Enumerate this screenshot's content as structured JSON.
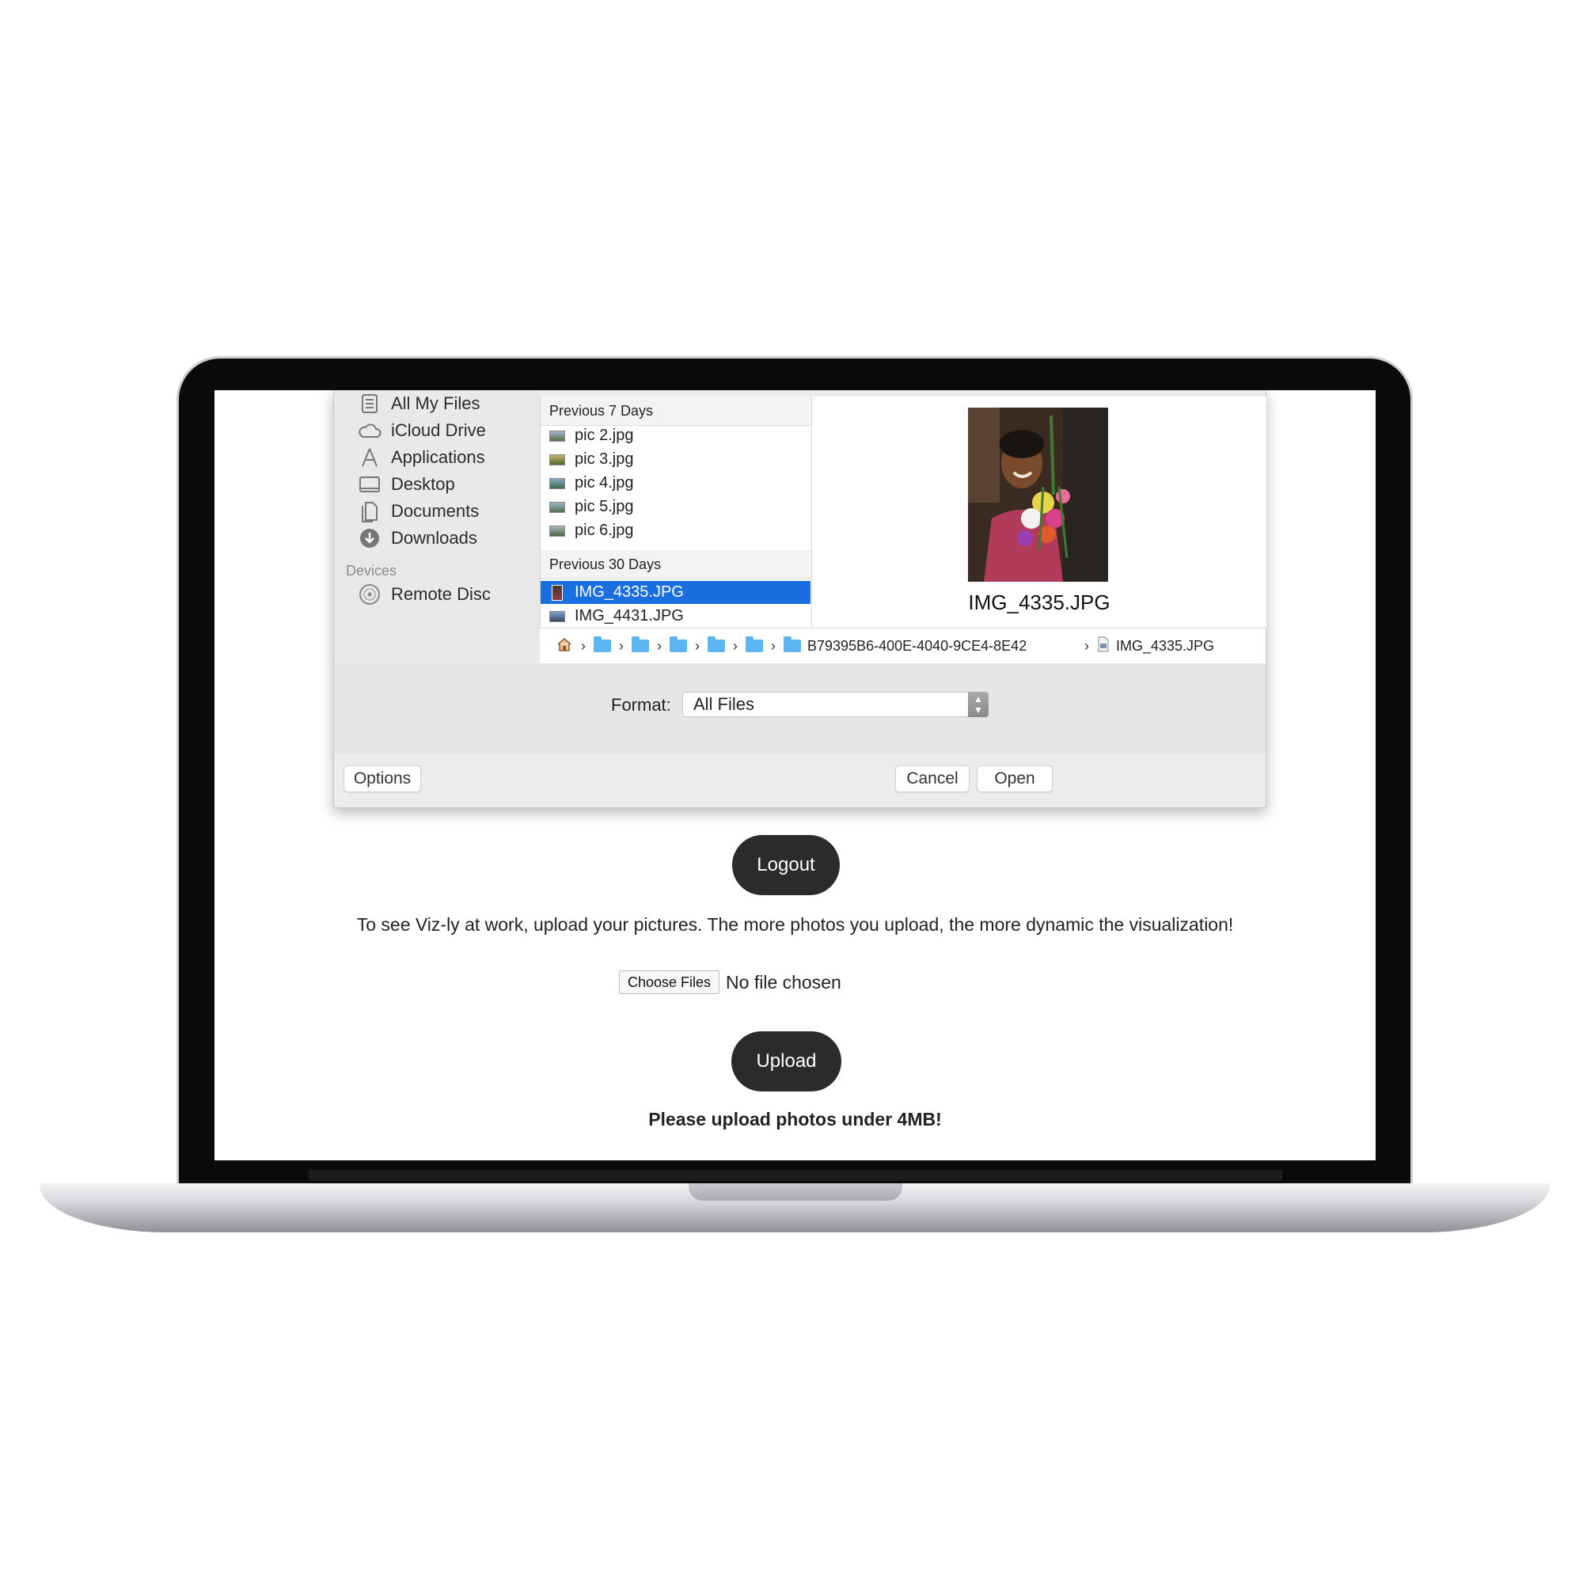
{
  "sidebar": {
    "items": [
      {
        "label": "All My Files",
        "icon": "all-files-icon"
      },
      {
        "label": "iCloud Drive",
        "icon": "cloud-icon"
      },
      {
        "label": "Applications",
        "icon": "applications-icon"
      },
      {
        "label": "Desktop",
        "icon": "desktop-icon"
      },
      {
        "label": "Documents",
        "icon": "documents-icon"
      },
      {
        "label": "Downloads",
        "icon": "downloads-icon"
      }
    ],
    "devices_heading": "Devices",
    "devices": [
      {
        "label": "Remote Disc",
        "icon": "disc-icon"
      }
    ]
  },
  "files": {
    "group1": {
      "heading": "Previous 7 Days",
      "items": [
        "pic 2.jpg",
        "pic 3.jpg",
        "pic 4.jpg",
        "pic 5.jpg",
        "pic 6.jpg"
      ]
    },
    "group2": {
      "heading": "Previous 30 Days",
      "items": [
        "IMG_4335.JPG",
        "IMG_4431.JPG"
      ],
      "selected": "IMG_4335.JPG"
    }
  },
  "preview": {
    "filename": "IMG_4335.JPG"
  },
  "path": {
    "long_folder": "B79395B6-400E-4040-9CE4-8E42",
    "file": "IMG_4335.JPG"
  },
  "format": {
    "label": "Format:",
    "value": "All Files"
  },
  "dialog_buttons": {
    "options": "Options",
    "cancel": "Cancel",
    "open": "Open"
  },
  "page": {
    "logout": "Logout",
    "intro": "To see Viz-ly at work, upload your pictures. The more photos you upload, the more dynamic the visualization!",
    "choose_files": "Choose Files",
    "no_file": "No file chosen",
    "upload": "Upload",
    "note": "Please upload photos under 4MB!"
  },
  "colors": {
    "selection": "#1a6fe0",
    "button_dark": "#2b2b2b",
    "folder": "#5bb5f0"
  }
}
